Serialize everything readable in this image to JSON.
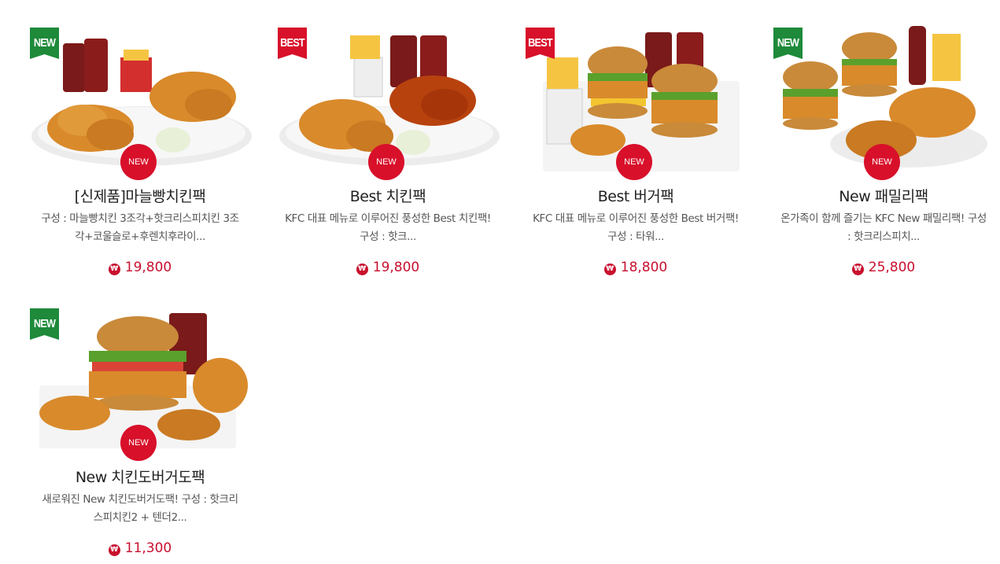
{
  "colors": {
    "accent": "#c8102e",
    "new_ribbon": "#1e8a3a",
    "best_ribbon": "#d8102a"
  },
  "products": [
    {
      "ribbon": "NEW",
      "ribbon_color": "#1e8a3a",
      "badge": "NEW",
      "title": "[신제품]마늘빵치킨팩",
      "desc_line1": "구성 : 마늘빵치킨 3조각+핫크리스피치킨 3조",
      "desc_line2": "각+코울슬로+후렌치후라이...",
      "currency_icon": "won-icon",
      "currency_symbol": "₩",
      "price": "19,800"
    },
    {
      "ribbon": "BEST",
      "ribbon_color": "#d8102a",
      "badge": "NEW",
      "title": "Best 치킨팩",
      "desc_line1": "KFC 대표 메뉴로 이루어진 풍성한 Best 치킨팩!",
      "desc_line2": "구성 : 핫크...",
      "currency_icon": "won-icon",
      "currency_symbol": "₩",
      "price": "19,800"
    },
    {
      "ribbon": "BEST",
      "ribbon_color": "#d8102a",
      "badge": "NEW",
      "title": "Best 버거팩",
      "desc_line1": "KFC 대표 메뉴로 이루어진 풍성한 Best 버거팩!",
      "desc_line2": "구성 : 타워...",
      "currency_icon": "won-icon",
      "currency_symbol": "₩",
      "price": "18,800"
    },
    {
      "ribbon": "NEW",
      "ribbon_color": "#1e8a3a",
      "badge": "NEW",
      "title": "New 패밀리팩",
      "desc_line1": "온가족이 함께 즐기는 KFC New 패밀리팩! 구성",
      "desc_line2": ": 핫크리스피치...",
      "currency_icon": "won-icon",
      "currency_symbol": "₩",
      "price": "25,800"
    },
    {
      "ribbon": "NEW",
      "ribbon_color": "#1e8a3a",
      "badge": "NEW",
      "title": "New 치킨도버거도팩",
      "desc_line1": "새로워진 New 치킨도버거도팩! 구성 : 핫크리",
      "desc_line2": "스피치킨2 + 텐더2...",
      "currency_icon": "won-icon",
      "currency_symbol": "₩",
      "price": "11,300"
    }
  ]
}
